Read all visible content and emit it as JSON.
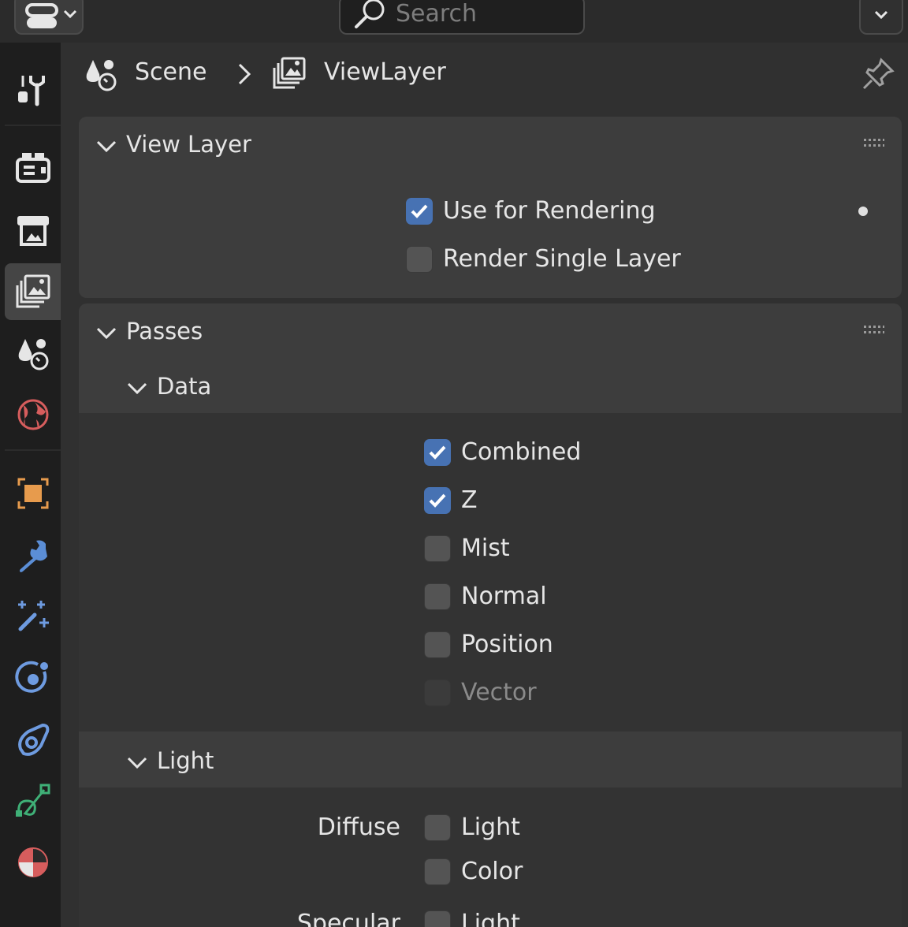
{
  "header": {
    "search_placeholder": "Search"
  },
  "sidebar": {
    "tabs": [
      {
        "name": "tool",
        "icon": "tool-icon",
        "active": false
      },
      {
        "name": "render",
        "icon": "render-icon",
        "active": false
      },
      {
        "name": "output",
        "icon": "output-icon",
        "active": false
      },
      {
        "name": "view-layer",
        "icon": "view-layer-icon",
        "active": true
      },
      {
        "name": "scene",
        "icon": "scene-icon",
        "active": false
      },
      {
        "name": "world",
        "icon": "world-icon",
        "active": false
      },
      {
        "name": "object",
        "icon": "object-icon",
        "active": false
      },
      {
        "name": "modifiers",
        "icon": "wrench-icon",
        "active": false
      },
      {
        "name": "particles",
        "icon": "particles-icon",
        "active": false
      },
      {
        "name": "physics",
        "icon": "physics-icon",
        "active": false
      },
      {
        "name": "constraints",
        "icon": "constraints-icon",
        "active": false
      },
      {
        "name": "data",
        "icon": "data-icon",
        "active": false
      },
      {
        "name": "material",
        "icon": "material-icon",
        "active": false
      }
    ]
  },
  "breadcrumb": {
    "scene": "Scene",
    "view_layer": "ViewLayer"
  },
  "view_layer_panel": {
    "title": "View Layer",
    "use_for_rendering": {
      "label": "Use for Rendering",
      "checked": true
    },
    "render_single_layer": {
      "label": "Render Single Layer",
      "checked": false
    }
  },
  "passes_panel": {
    "title": "Passes",
    "data": {
      "title": "Data",
      "items": [
        {
          "label": "Combined",
          "checked": true,
          "enabled": true
        },
        {
          "label": "Z",
          "checked": true,
          "enabled": true
        },
        {
          "label": "Mist",
          "checked": false,
          "enabled": true
        },
        {
          "label": "Normal",
          "checked": false,
          "enabled": true
        },
        {
          "label": "Position",
          "checked": false,
          "enabled": true
        },
        {
          "label": "Vector",
          "checked": false,
          "enabled": false
        }
      ]
    },
    "light": {
      "title": "Light",
      "diffuse_label": "Diffuse",
      "diffuse_light": "Light",
      "diffuse_color": "Color",
      "specular_label": "Specular",
      "specular_light": "Light"
    }
  },
  "colors": {
    "accent": "#4772b3",
    "background": "#303030",
    "panel": "#3d3d3d"
  }
}
